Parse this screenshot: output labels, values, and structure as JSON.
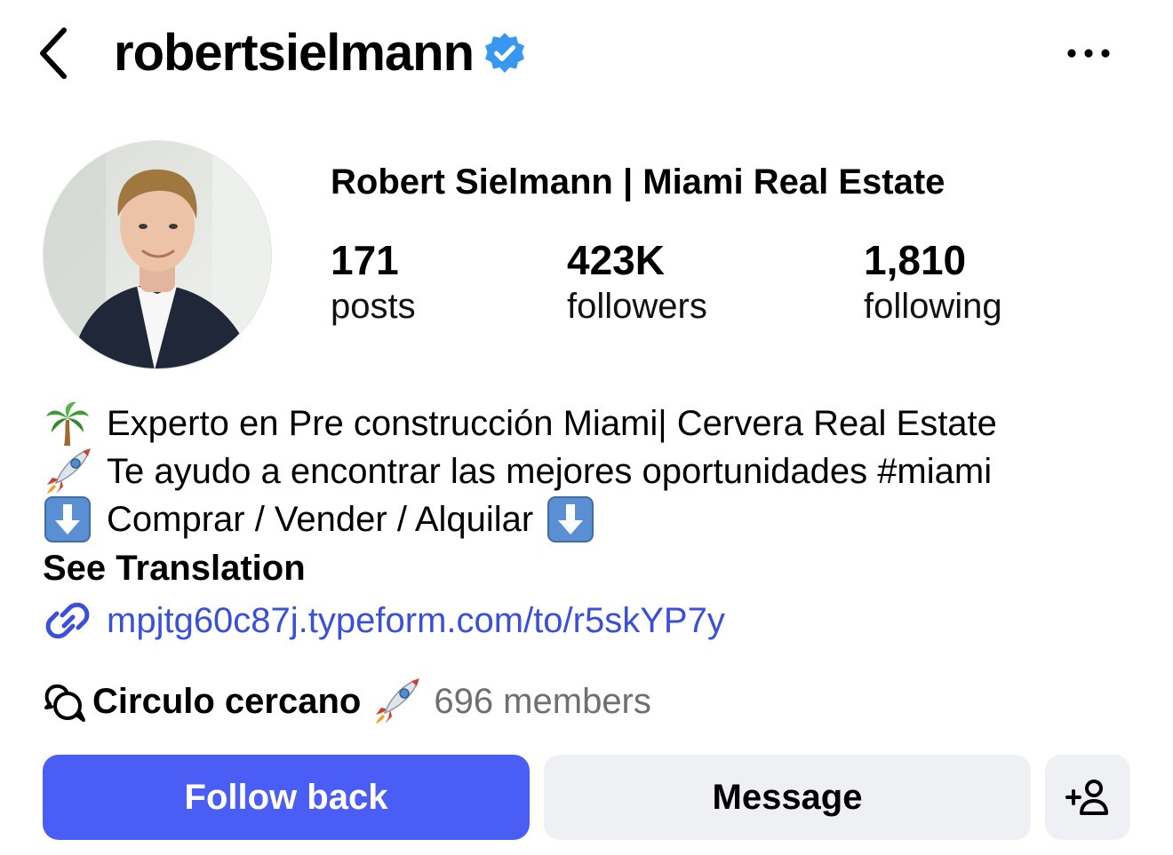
{
  "header": {
    "username": "robertsielmann",
    "back_icon": "chevron-left-icon",
    "verified_icon": "verified-badge-icon",
    "verified_color": "#3897f0",
    "more_icon": "more-horizontal-icon"
  },
  "profile": {
    "full_name": "Robert Sielmann | Miami Real Estate",
    "stats": {
      "posts": {
        "value": "171",
        "label": "posts"
      },
      "followers": {
        "value": "423K",
        "label": "followers"
      },
      "following": {
        "value": "1,810",
        "label": "following"
      }
    }
  },
  "bio": {
    "lines": [
      {
        "emoji": "palm-tree-icon",
        "text": "Experto en Pre construcción Miami| Cervera Real Estate"
      },
      {
        "emoji": "rocket-icon",
        "text": "Te ayudo a encontrar las mejores oportunidades #miami"
      },
      {
        "emoji": "down-arrow-icon",
        "text": "Comprar / Vender / Alquilar",
        "trailing_emoji": "down-arrow-icon"
      }
    ],
    "see_translation": "See Translation"
  },
  "link": {
    "icon": "link-icon",
    "text": "mpjtg60c87j.typeform.com/to/r5skYP7y",
    "color": "#3b50d8"
  },
  "channel": {
    "icon": "broadcast-chat-icon",
    "name": "Circulo cercano",
    "emoji": "rocket-icon",
    "members": "696 members"
  },
  "actions": {
    "follow_back": "Follow back",
    "message": "Message",
    "suggest_icon": "add-person-icon",
    "accent_color": "#4a5df5",
    "secondary_bg": "#eef0f4"
  }
}
